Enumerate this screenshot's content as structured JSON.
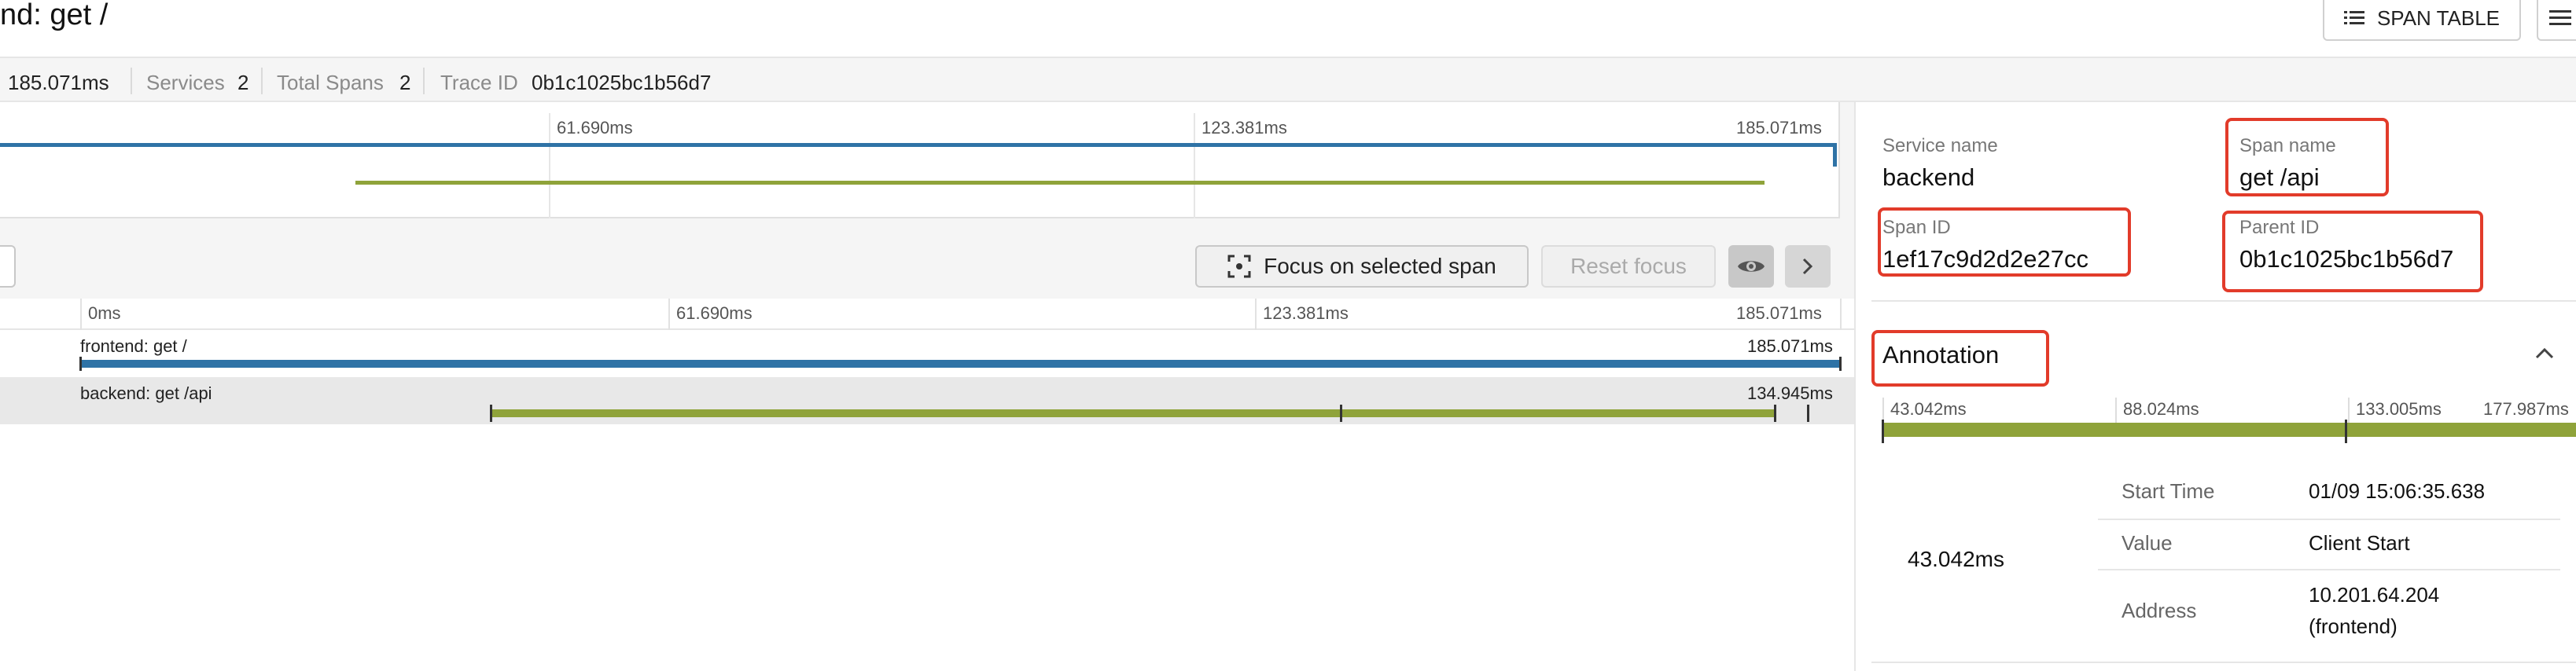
{
  "header": {
    "title": "nd: get /",
    "span_table_label": "SPAN TABLE"
  },
  "summary": {
    "duration": "185.071ms",
    "services_label": "Services",
    "services_value": "2",
    "total_spans_label": "Total Spans",
    "total_spans_value": "2",
    "trace_id_label": "Trace ID",
    "trace_id_value": "0b1c1025bc1b56d7"
  },
  "minimap": {
    "ticks": [
      "61.690ms",
      "123.381ms",
      "185.071ms"
    ]
  },
  "toolbar": {
    "focus_label": "Focus on selected span",
    "reset_label": "Reset focus"
  },
  "timeline": {
    "ticks": [
      "0ms",
      "61.690ms",
      "123.381ms",
      "185.071ms"
    ],
    "rows": [
      {
        "label": "frontend: get /",
        "duration": "185.071ms",
        "color": "#2f73a6"
      },
      {
        "label": "backend: get /api",
        "duration": "134.945ms",
        "color": "#8fa33a"
      }
    ]
  },
  "detail": {
    "service_name_label": "Service name",
    "service_name_value": "backend",
    "span_name_label": "Span name",
    "span_name_value": "get /api",
    "span_id_label": "Span ID",
    "span_id_value": "1ef17c9d2d2e27cc",
    "parent_id_label": "Parent ID",
    "parent_id_value": "0b1c1025bc1b56d7",
    "annotation_title": "Annotation",
    "annotation_ticks": [
      "43.042ms",
      "88.024ms",
      "133.005ms",
      "177.987ms"
    ],
    "annotation_time": "43.042ms",
    "kv": [
      {
        "label": "Start Time",
        "value": "01/09 15:06:35.638"
      },
      {
        "label": "Value",
        "value": "Client Start"
      },
      {
        "label": "Address",
        "value": "10.201.64.204",
        "value2": "(frontend)"
      }
    ]
  },
  "colors": {
    "frontend": "#2f73a6",
    "backend": "#8fa33a",
    "highlight": "#e23b2a"
  }
}
